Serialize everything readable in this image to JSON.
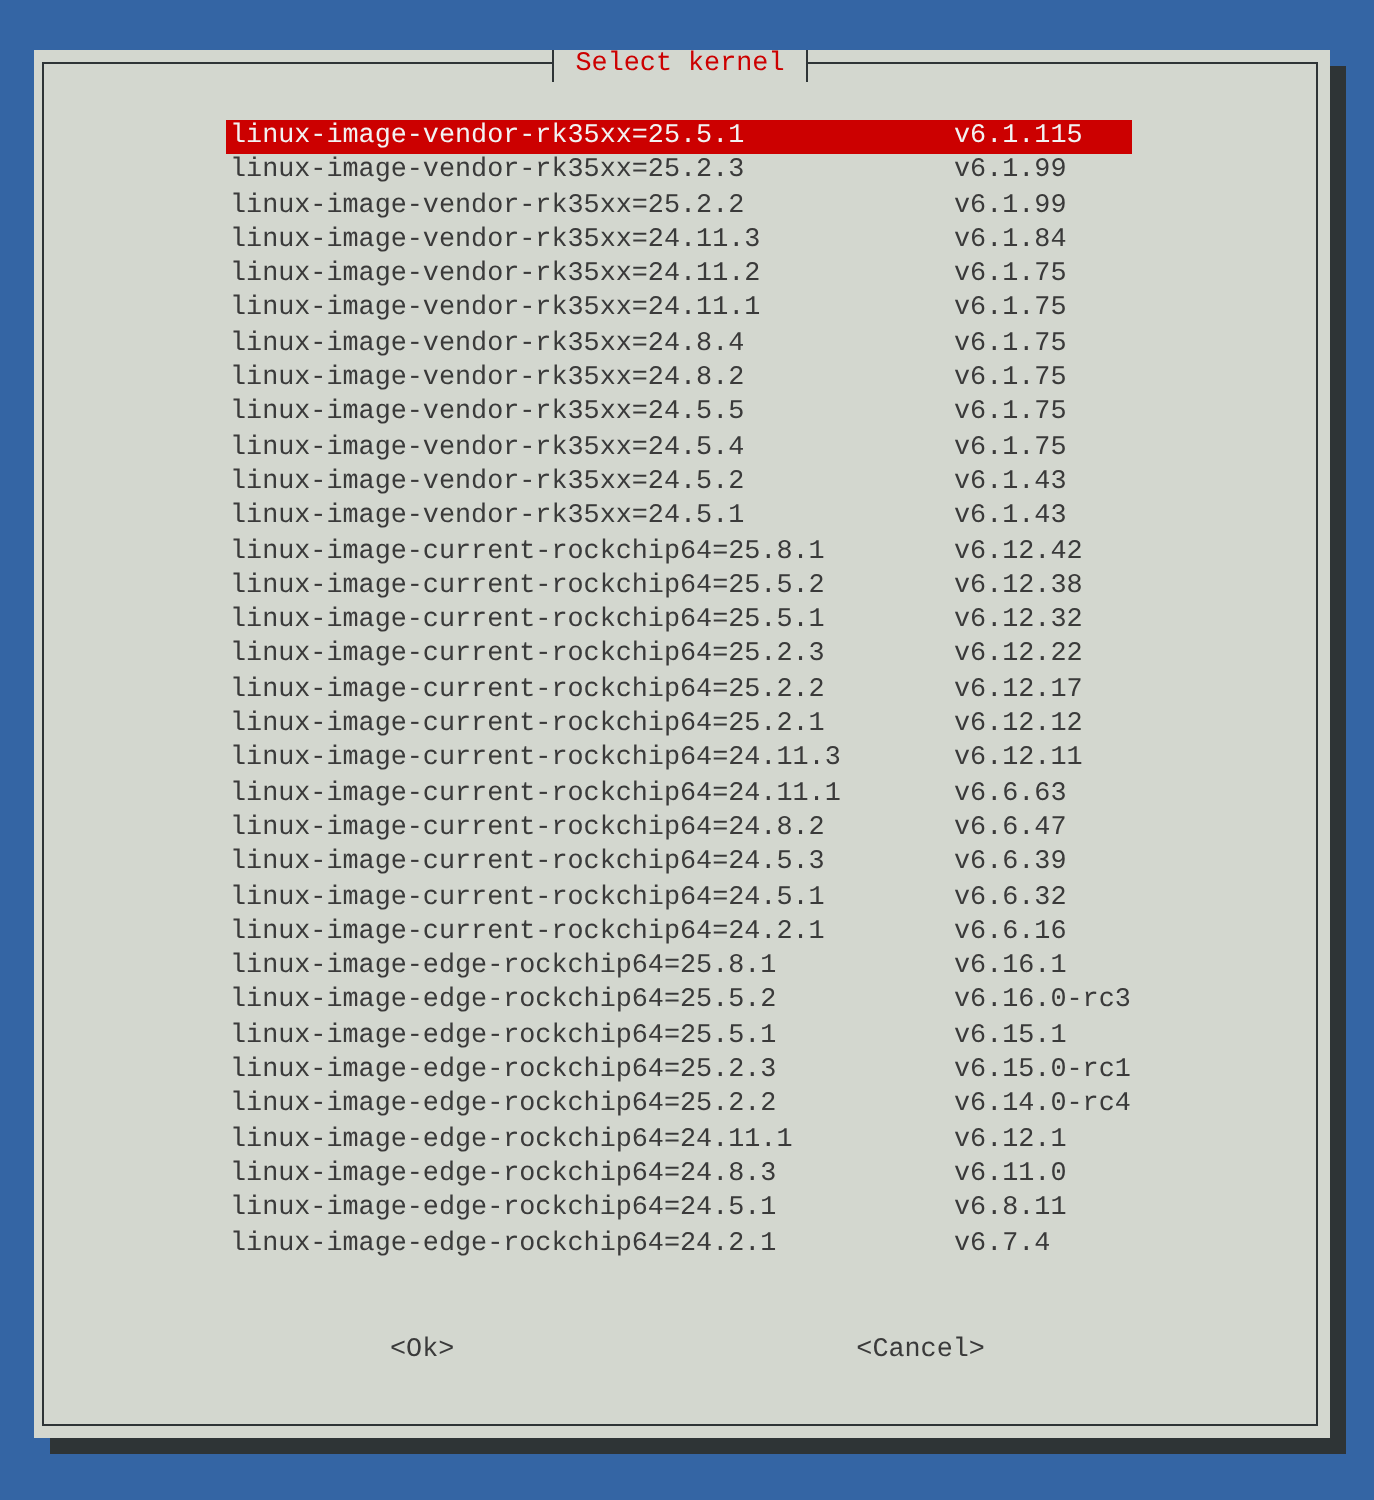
{
  "dialog": {
    "title": "Select kernel"
  },
  "items": [
    {
      "name": "linux-image-vendor-rk35xx=25.5.1",
      "version": "v6.1.115",
      "selected": true
    },
    {
      "name": "linux-image-vendor-rk35xx=25.2.3",
      "version": "v6.1.99",
      "selected": false
    },
    {
      "name": "linux-image-vendor-rk35xx=25.2.2",
      "version": "v6.1.99",
      "selected": false
    },
    {
      "name": "linux-image-vendor-rk35xx=24.11.3",
      "version": "v6.1.84",
      "selected": false
    },
    {
      "name": "linux-image-vendor-rk35xx=24.11.2",
      "version": "v6.1.75",
      "selected": false
    },
    {
      "name": "linux-image-vendor-rk35xx=24.11.1",
      "version": "v6.1.75",
      "selected": false
    },
    {
      "name": "linux-image-vendor-rk35xx=24.8.4",
      "version": "v6.1.75",
      "selected": false
    },
    {
      "name": "linux-image-vendor-rk35xx=24.8.2",
      "version": "v6.1.75",
      "selected": false
    },
    {
      "name": "linux-image-vendor-rk35xx=24.5.5",
      "version": "v6.1.75",
      "selected": false
    },
    {
      "name": "linux-image-vendor-rk35xx=24.5.4",
      "version": "v6.1.75",
      "selected": false
    },
    {
      "name": "linux-image-vendor-rk35xx=24.5.2",
      "version": "v6.1.43",
      "selected": false
    },
    {
      "name": "linux-image-vendor-rk35xx=24.5.1",
      "version": "v6.1.43",
      "selected": false
    },
    {
      "name": "linux-image-current-rockchip64=25.8.1",
      "version": "v6.12.42",
      "selected": false
    },
    {
      "name": "linux-image-current-rockchip64=25.5.2",
      "version": "v6.12.38",
      "selected": false
    },
    {
      "name": "linux-image-current-rockchip64=25.5.1",
      "version": "v6.12.32",
      "selected": false
    },
    {
      "name": "linux-image-current-rockchip64=25.2.3",
      "version": "v6.12.22",
      "selected": false
    },
    {
      "name": "linux-image-current-rockchip64=25.2.2",
      "version": "v6.12.17",
      "selected": false
    },
    {
      "name": "linux-image-current-rockchip64=25.2.1",
      "version": "v6.12.12",
      "selected": false
    },
    {
      "name": "linux-image-current-rockchip64=24.11.3",
      "version": "v6.12.11",
      "selected": false
    },
    {
      "name": "linux-image-current-rockchip64=24.11.1",
      "version": "v6.6.63",
      "selected": false
    },
    {
      "name": "linux-image-current-rockchip64=24.8.2",
      "version": "v6.6.47",
      "selected": false
    },
    {
      "name": "linux-image-current-rockchip64=24.5.3",
      "version": "v6.6.39",
      "selected": false
    },
    {
      "name": "linux-image-current-rockchip64=24.5.1",
      "version": "v6.6.32",
      "selected": false
    },
    {
      "name": "linux-image-current-rockchip64=24.2.1",
      "version": "v6.6.16",
      "selected": false
    },
    {
      "name": "linux-image-edge-rockchip64=25.8.1",
      "version": "v6.16.1",
      "selected": false
    },
    {
      "name": "linux-image-edge-rockchip64=25.5.2",
      "version": "v6.16.0-rc3",
      "selected": false
    },
    {
      "name": "linux-image-edge-rockchip64=25.5.1",
      "version": "v6.15.1",
      "selected": false
    },
    {
      "name": "linux-image-edge-rockchip64=25.2.3",
      "version": "v6.15.0-rc1",
      "selected": false
    },
    {
      "name": "linux-image-edge-rockchip64=25.2.2",
      "version": "v6.14.0-rc4",
      "selected": false
    },
    {
      "name": "linux-image-edge-rockchip64=24.11.1",
      "version": "v6.12.1",
      "selected": false
    },
    {
      "name": "linux-image-edge-rockchip64=24.8.3",
      "version": "v6.11.0",
      "selected": false
    },
    {
      "name": "linux-image-edge-rockchip64=24.5.1",
      "version": "v6.8.11",
      "selected": false
    },
    {
      "name": "linux-image-edge-rockchip64=24.2.1",
      "version": "v6.7.4",
      "selected": false
    }
  ],
  "buttons": [
    "<Ok>",
    "<Cancel>"
  ]
}
